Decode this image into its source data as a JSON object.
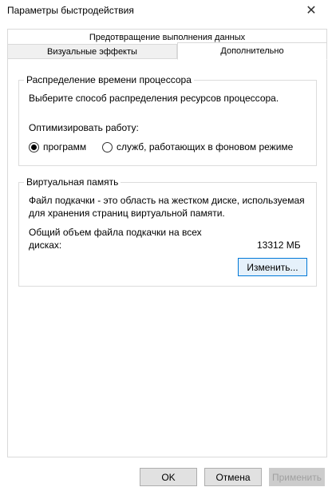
{
  "window": {
    "title": "Параметры быстродействия"
  },
  "tabs": {
    "dep": "Предотвращение выполнения данных",
    "visual": "Визуальные эффекты",
    "advanced": "Дополнительно"
  },
  "cpu": {
    "title": "Распределение времени процессора",
    "description": "Выберите способ распределения ресурсов процессора.",
    "optimize_label": "Оптимизировать работу:",
    "option_programs": "программ",
    "option_services": "служб, работающих в фоновом режиме",
    "selected": "программ"
  },
  "vm": {
    "title": "Виртуальная память",
    "description_line1": "Файл подкачки - это область на жестком диске, используемая",
    "description_line2": "для хранения страниц виртуальной памяти.",
    "total_label_line1": "Общий объем файла подкачки на всех",
    "total_label_line2": "дисках:",
    "total_value": "13312 МБ",
    "change_button": "Изменить..."
  },
  "footer": {
    "ok": "OK",
    "cancel": "Отмена",
    "apply": "Применить"
  }
}
